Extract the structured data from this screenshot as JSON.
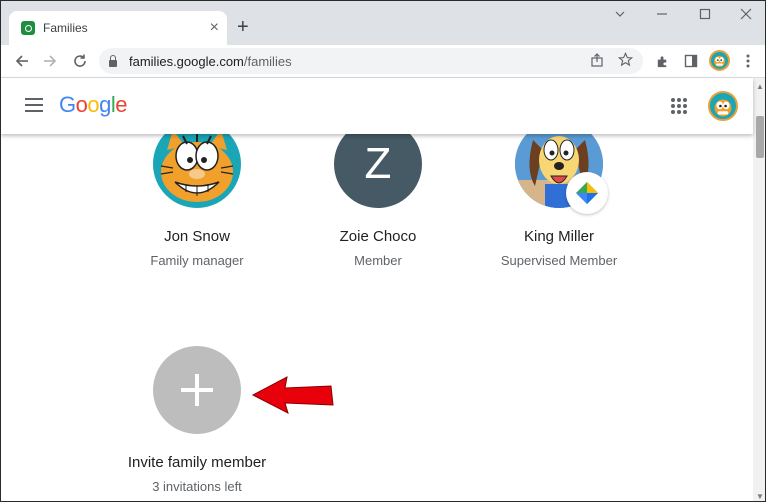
{
  "browser": {
    "tab": {
      "title": "Families",
      "favicon": "google-families-icon",
      "close_label": "×"
    },
    "new_tab_label": "+",
    "window_controls": {
      "minimize": "—",
      "maximize": "☐",
      "close": "✕"
    },
    "toolbar": {
      "url_host": "families.google.com",
      "url_path": "/families",
      "icons": [
        "back-icon",
        "forward-icon",
        "reload-icon",
        "lock-icon",
        "share-icon",
        "star-icon",
        "extensions-icon",
        "side-panel-icon",
        "profile-avatar",
        "menu-icon"
      ]
    }
  },
  "header": {
    "logo_letters": [
      "G",
      "o",
      "o",
      "g",
      "l",
      "e"
    ],
    "logo_colors": [
      "#4285f4",
      "#ea4335",
      "#fbbc05",
      "#4285f4",
      "#34a853",
      "#ea4335"
    ]
  },
  "members": [
    {
      "name": "Jon Snow",
      "role": "Family manager",
      "avatar": "garfield-avatar"
    },
    {
      "name": "Zoie Choco",
      "role": "Member",
      "avatar_initial": "Z",
      "avatar_color": "#455a64"
    },
    {
      "name": "King Miller",
      "role": "Supervised Member",
      "avatar": "odie-avatar",
      "badge": "family-link-icon"
    }
  ],
  "invite": {
    "label": "Invite family member",
    "sublabel": "3 invitations left",
    "annotation": "red-arrow-pointing-left",
    "annotation_color": "#e8000b"
  }
}
